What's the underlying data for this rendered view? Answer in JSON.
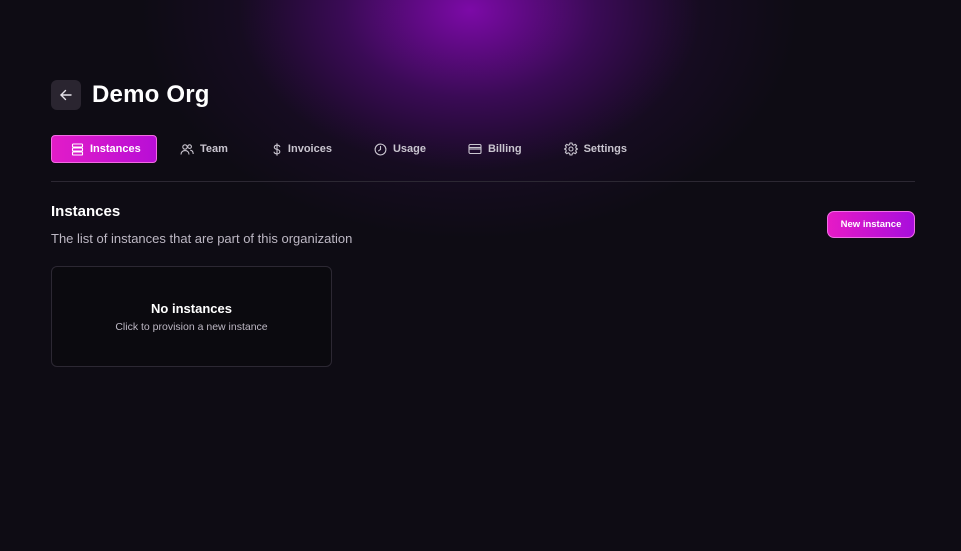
{
  "header": {
    "back_icon": "arrow-left-icon",
    "org_name": "Demo Org"
  },
  "tabs": [
    {
      "label": "Instances",
      "icon": "server-stack-icon",
      "active": true
    },
    {
      "label": "Team",
      "icon": "users-icon",
      "active": false
    },
    {
      "label": "Invoices",
      "icon": "dollar-icon",
      "active": false
    },
    {
      "label": "Usage",
      "icon": "clock-icon",
      "active": false
    },
    {
      "label": "Billing",
      "icon": "credit-card-icon",
      "active": false
    },
    {
      "label": "Settings",
      "icon": "gear-icon",
      "active": false
    }
  ],
  "section": {
    "title": "Instances",
    "description": "The list of instances that are part of this organization",
    "new_button_label": "New instance"
  },
  "empty_state": {
    "title": "No instances",
    "subtitle": "Click to provision a new instance"
  },
  "colors": {
    "background": "#0e0c14",
    "accent_start": "#e21cc8",
    "accent_end": "#b80ed6",
    "glow": "#820aaf"
  }
}
